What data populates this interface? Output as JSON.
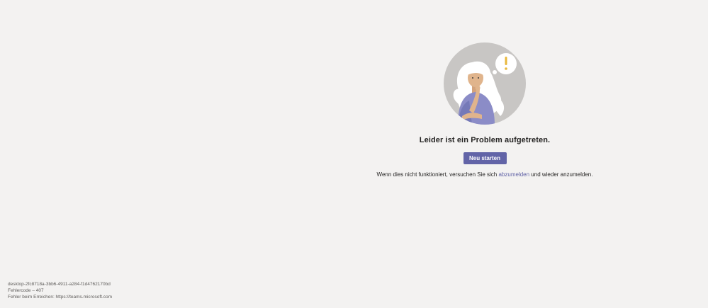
{
  "error": {
    "illustration_icon": "woman-thinking-exclamation-illustration",
    "title": "Leider ist ein Problem aufgetreten.",
    "restart_label": "Neu starten",
    "hint_before": "Wenn dies nicht funktioniert, versuchen Sie sich ",
    "hint_link": "abzumelden",
    "hint_after": " und wieder anzumelden."
  },
  "footer": {
    "session_id": "desktop-2fc8718a-3bb6-4911-a284-f1d4762170bd",
    "error_code": "Fehlercode – 407",
    "reach_error": "Fehler beim Erreichen: https://teams.microsoft.com"
  },
  "colors": {
    "background": "#f3f2f1",
    "accent": "#6264a7",
    "text": "#252423",
    "muted_text": "#605e5c"
  }
}
